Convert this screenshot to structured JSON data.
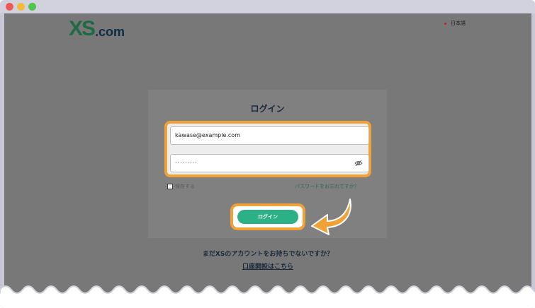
{
  "header": {
    "logo_main": "XS",
    "logo_suffix": ".com",
    "language": "日本語"
  },
  "login": {
    "title": "ログイン",
    "email_value": "kawase@example.com",
    "password_value": "·········",
    "remember_label": "保存する",
    "forgot_link": "パスワードをお忘れですか？",
    "submit_label": "ログイン"
  },
  "footer": {
    "no_account_text": "まだXSのアカウントをお持ちでないですか？",
    "open_account_link": "口座開設はこちら"
  },
  "colors": {
    "brand_green": "#1f6a45",
    "button_green": "#2bb185",
    "highlight_orange": "#f0a236",
    "overlay_gray": "#787878"
  }
}
